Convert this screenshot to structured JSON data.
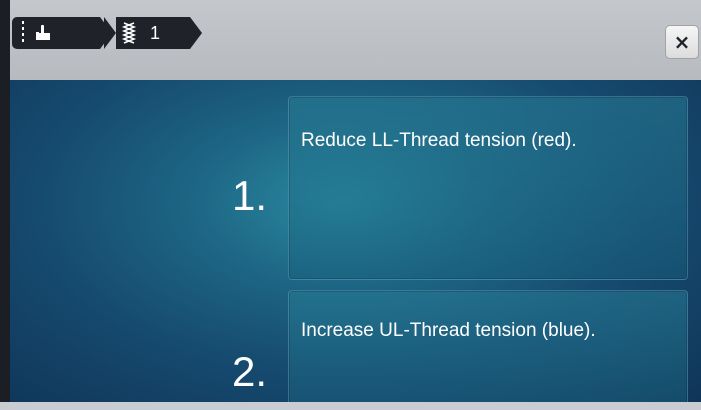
{
  "breadcrumb": {
    "items": [
      {
        "icon": "hand-pointer-icon"
      },
      {
        "icon": "stitch-icon",
        "label": "1"
      }
    ]
  },
  "close_button": {
    "label": "×"
  },
  "steps": [
    {
      "number": "1.",
      "text": "Reduce LL-Thread tension (red)."
    },
    {
      "number": "2.",
      "text": "Increase UL-Thread tension (blue)."
    }
  ],
  "colors": {
    "topbar": "#c0c3c7",
    "breadcrumb_bg": "#1f2329",
    "panel_dark": "#0f3558",
    "panel_glow": "#2a8aa0",
    "text": "#ffffff"
  }
}
